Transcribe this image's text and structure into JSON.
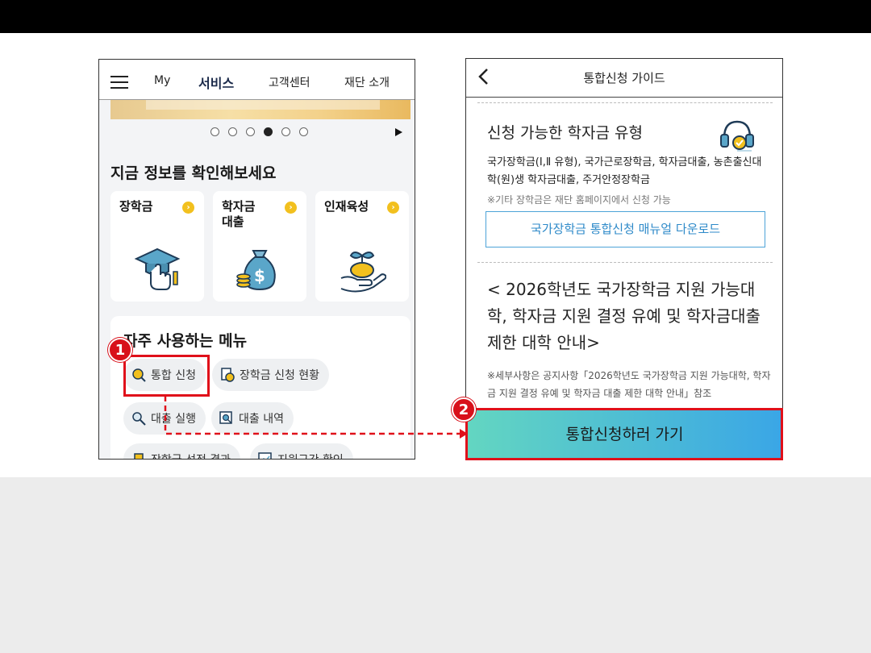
{
  "left": {
    "nav": {
      "my": "My",
      "services": "서비스",
      "support": "고객센터",
      "about": "재단 소개"
    },
    "section_title": "지금 정보를 확인해보세요",
    "cards": [
      {
        "label": "장학금",
        "arrow": "›"
      },
      {
        "label": "학자금\n대출",
        "arrow": "›"
      },
      {
        "label": "인재육성",
        "arrow": "›"
      }
    ],
    "frequent_title": "자주 사용하는 메뉴",
    "chips": {
      "integrated": "통합 신청",
      "status": "장학금 신청 현황",
      "loan_exec": "대출 실행",
      "loan_history": "대출 내역",
      "row3a": "장학금 선정 결과",
      "row3b": "지원구간 확인"
    },
    "badge1": "1"
  },
  "right": {
    "header_title": "통합신청 가이드",
    "heading1": "신청 가능한 학자금 유형",
    "body1": "국가장학금(Ⅰ,Ⅱ 유형), 국가근로장학금, 학자금대출, 농촌출신대학(원)생 학자금대출, 주거안정장학금",
    "note1": "※기타 장학금은 재단 홈페이지에서 신청 가능",
    "download_label": "국가장학금 통합신청 매뉴얼 다운로드",
    "heading2": "< 2026학년도 국가장학금 지원 가능대학, 학자금 지원 결정 유예 및 학자금대출 제한 대학 안내>",
    "small2": "※세부사항은 공지사항「2026학년도 국가장학금 지원 가능대학, 학자금 지원 결정 유예 및 학자금 대출 제한 대학 안내」참조",
    "go_label": "통합신청하러 가기",
    "badge2": "2"
  }
}
